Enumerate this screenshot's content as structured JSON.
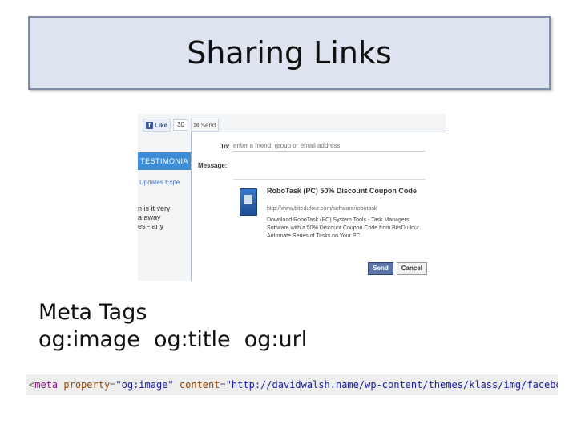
{
  "slide": {
    "title": "Sharing Links"
  },
  "facebook": {
    "like_label": "Like",
    "like_count": "30",
    "send_label": "Send",
    "testimonials_label": "TESTIMONIA",
    "updates_label": "Updates   Expe",
    "left_lines": [
      "n is it very",
      "a away",
      "es - any"
    ],
    "dialog": {
      "to_label": "To:",
      "to_placeholder": "enter a friend, group or email address",
      "message_label": "Message:",
      "preview_title": "RoboTask (PC) 50% Discount Coupon Code",
      "preview_url": "http://www.bitedufour.com/software/robotask",
      "preview_desc": "Download RoboTask (PC) System Tools - Task Managers Software with a 50% Discount Coupon Code from BitsDuJour. Automate Series of Tasks on Your PC.",
      "send_button": "Send",
      "cancel_button": "Cancel"
    }
  },
  "body": {
    "line1": "Meta Tags",
    "line2": "og:image  og:title  og:url"
  },
  "code": {
    "open": "<",
    "tag": "meta",
    "attr1": "property",
    "val1": "\"og:image\"",
    "attr2": "content",
    "val2": "\"http://davidwalsh.name/wp-content/themes/klass/img/facebooklogo.png\"",
    "close": "/>"
  }
}
